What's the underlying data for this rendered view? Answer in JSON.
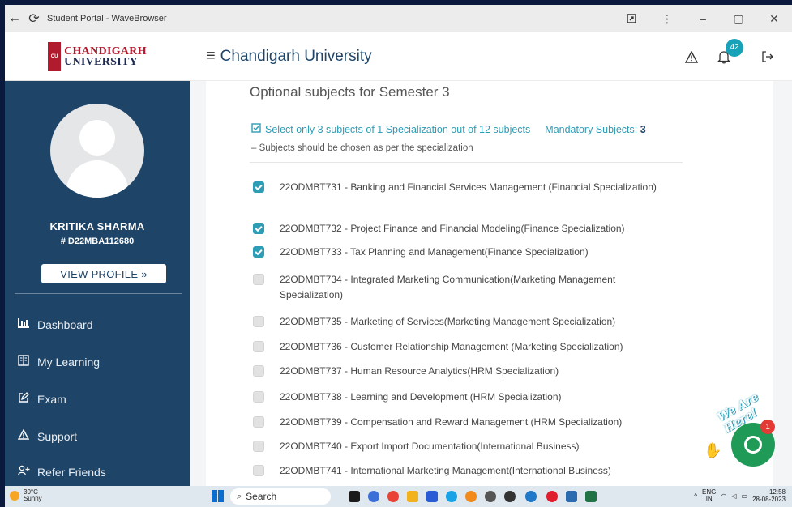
{
  "browser": {
    "title": "Student Portal - WaveBrowser",
    "back_icon": "←",
    "reload_icon": "⟳"
  },
  "sidebar": {
    "logo": {
      "line1": "CHANDIGARH",
      "line2": "UNIVERSITY",
      "emblem": "CU"
    },
    "user_name": "KRITIKA SHARMA",
    "user_id": "# D22MBA112680",
    "view_profile": "VIEW PROFILE »",
    "nav": [
      {
        "label": "Dashboard",
        "icon": "bar-chart-icon"
      },
      {
        "label": "My Learning",
        "icon": "book-icon"
      },
      {
        "label": "Exam",
        "icon": "edit-icon"
      },
      {
        "label": "Support",
        "icon": "warning-icon"
      },
      {
        "label": "Refer Friends",
        "icon": "add-user-icon"
      }
    ]
  },
  "header": {
    "brand": "Chandigarh University",
    "notification_count": "42"
  },
  "content": {
    "title": "Optional subjects for Semester 3",
    "instruction": "Select only 3 subjects of 1 Specialization out of 12 subjects",
    "mandatory_label": "Mandatory Subjects:",
    "mandatory_count": "3",
    "note": "Subjects should be chosen as per the specialization",
    "subjects": [
      {
        "text": "22ODMBT731 - Banking and Financial Services Management (Financial Specialization)",
        "checked": true
      },
      {
        "text": "22ODMBT732 - Project Finance and Financial Modeling(Finance Specialization)",
        "checked": true
      },
      {
        "text": "22ODMBT733 - Tax Planning and Management(Finance Specialization)",
        "checked": true
      },
      {
        "text": "22ODMBT734 - Integrated Marketing Communication(Marketing Management Specialization)",
        "checked": false
      },
      {
        "text": "22ODMBT735 - Marketing of Services(Marketing Management Specialization)",
        "checked": false
      },
      {
        "text": "22ODMBT736 - Customer Relationship Management (Marketing Specialization)",
        "checked": false
      },
      {
        "text": "22ODMBT737 - Human Resource Analytics(HRM Specialization)",
        "checked": false
      },
      {
        "text": "22ODMBT738 - Learning and Development (HRM Specialization)",
        "checked": false
      },
      {
        "text": "22ODMBT739 - Compensation and Reward Management (HRM Specialization)",
        "checked": false
      },
      {
        "text": "22ODMBT740 - Export Import Documentation(International Business)",
        "checked": false
      },
      {
        "text": "22ODMBT741 - International Marketing Management(International Business)",
        "checked": false
      }
    ]
  },
  "chat": {
    "label": "We Are Here!",
    "badge": "1"
  },
  "taskbar": {
    "weather_temp": "30°C",
    "weather_desc": "Sunny",
    "search": "Search",
    "lang1": "ENG",
    "lang2": "IN",
    "time": "12:58",
    "date": "28-08-2023"
  },
  "colors": {
    "sidebar_bg": "#1e4468",
    "accent": "#2d9cb5",
    "brand_red": "#b01c2e"
  }
}
